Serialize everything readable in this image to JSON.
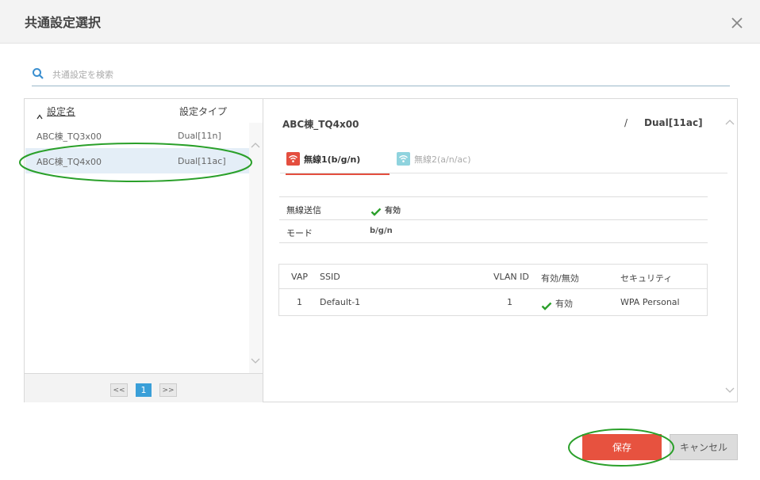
{
  "dialog": {
    "title": "共通設定選択"
  },
  "search": {
    "placeholder": "共通設定を検索",
    "value": ""
  },
  "list": {
    "headers": {
      "name": "設定名",
      "type": "設定タイプ"
    },
    "rows": [
      {
        "name": "ABC棟_TQ3x00",
        "type": "Dual[11n]",
        "selected": false
      },
      {
        "name": "ABC棟_TQ4x00",
        "type": "Dual[11ac]",
        "selected": true
      }
    ]
  },
  "pagination": {
    "prev": "<<",
    "current": "1",
    "next": ">>"
  },
  "detail": {
    "name": "ABC棟_TQ4x00",
    "separator": "/",
    "type": "Dual[11ac]",
    "tabs": [
      {
        "label": "無線1(b/g/n)",
        "active": true
      },
      {
        "label": "無線2(a/n/ac)",
        "active": false
      }
    ],
    "status": [
      {
        "label": "無線送信",
        "value": "有効"
      },
      {
        "label": "モード",
        "value": "b/g/n"
      }
    ],
    "vap": {
      "headers": [
        "VAP",
        "SSID",
        "VLAN ID",
        "有効/無効",
        "セキュリティ"
      ],
      "rows": [
        {
          "vap": "1",
          "ssid": "Default-1",
          "vlan": "1",
          "enabled": "有効",
          "security": "WPA Personal"
        }
      ]
    }
  },
  "buttons": {
    "save": "保存",
    "cancel": "キャンセル"
  },
  "colors": {
    "accent": "#e7523f",
    "pagination_active": "#3a9fd8",
    "check": "#2ca02c",
    "annotation_ellipse": "#2aa02a",
    "tab2_icon": "#8fd3de"
  },
  "icons": [
    "close-icon",
    "search-icon",
    "sort-up-icon",
    "chevron-up-icon",
    "chevron-down-icon",
    "wifi-icon",
    "check-icon"
  ]
}
